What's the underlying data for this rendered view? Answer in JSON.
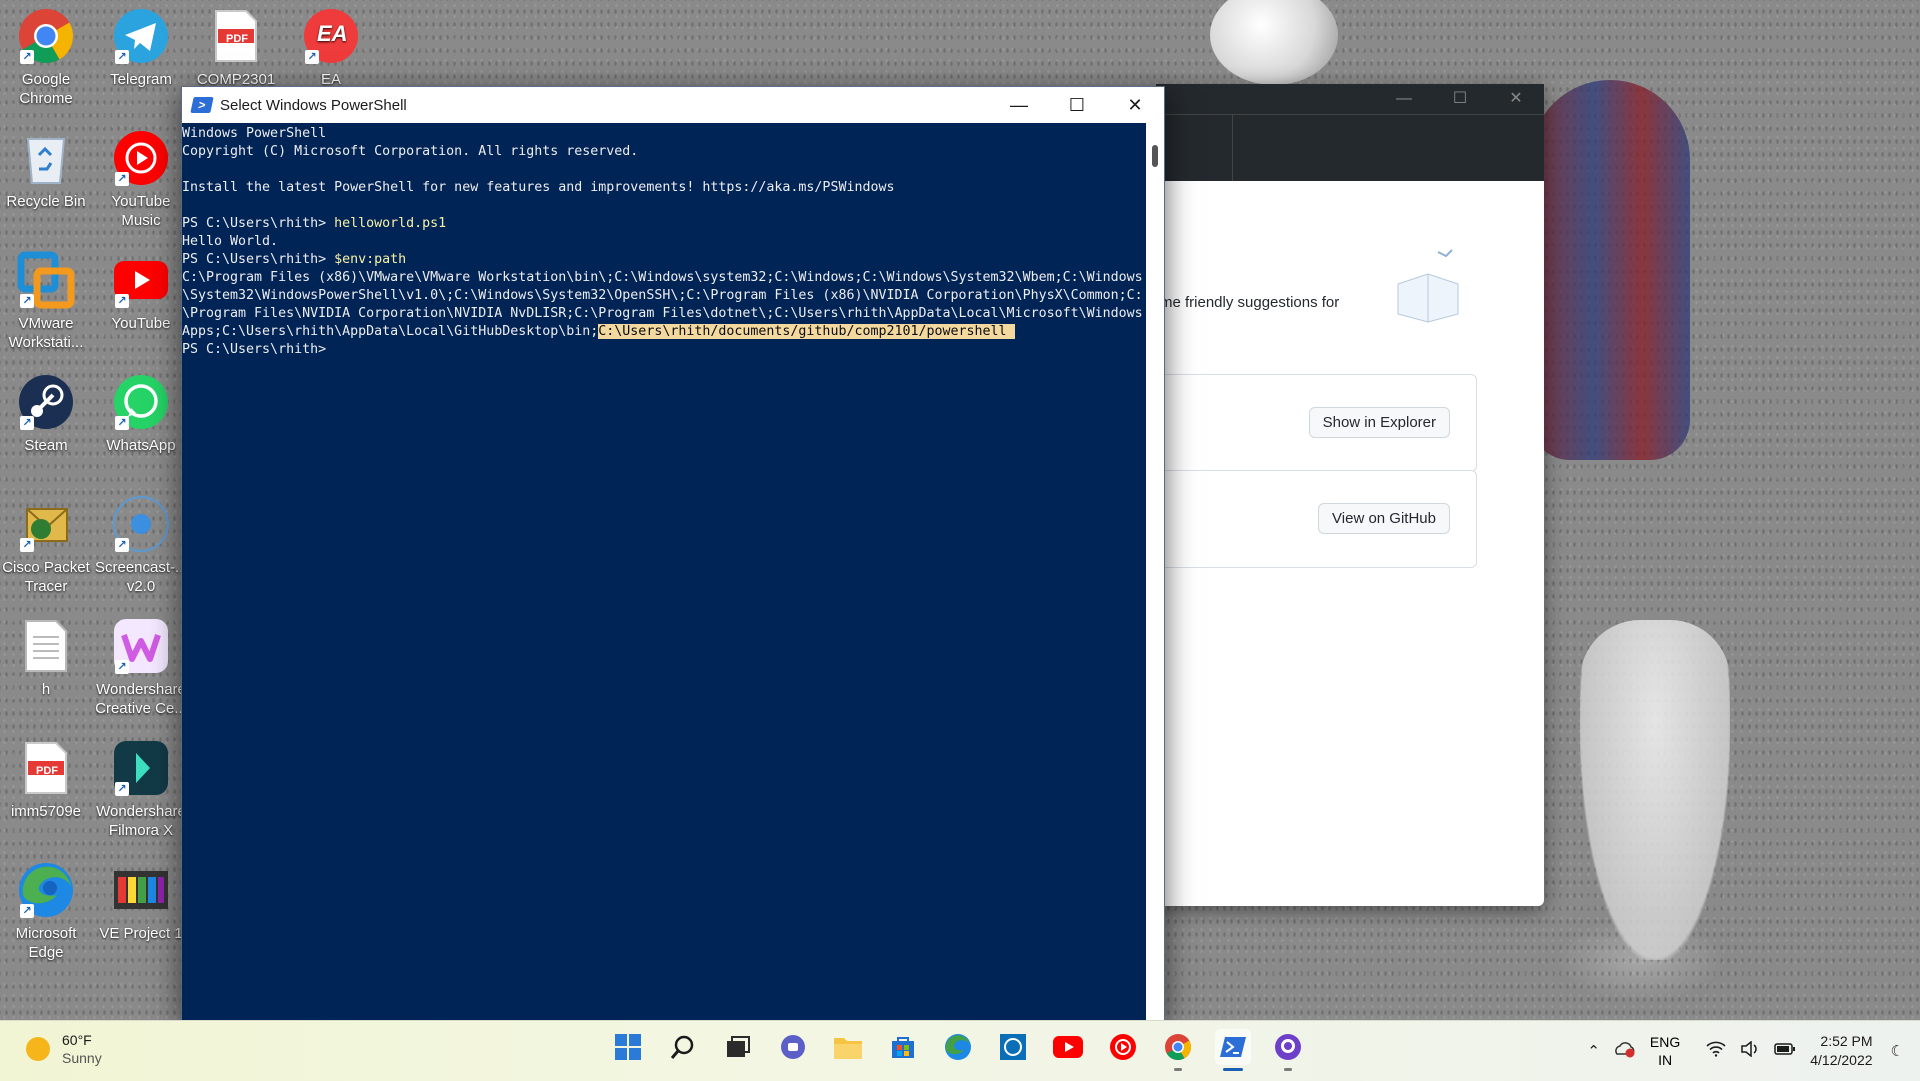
{
  "desktop": {
    "icons": [
      {
        "label": "Google Chrome"
      },
      {
        "label": "Telegram"
      },
      {
        "label": "COMP2301"
      },
      {
        "label": "EA"
      },
      {
        "label": "Recycle Bin"
      },
      {
        "label": "YouTube Music"
      },
      {
        "label": "VMware Workstati..."
      },
      {
        "label": "YouTube"
      },
      {
        "label": "Steam"
      },
      {
        "label": "WhatsApp"
      },
      {
        "label": "Cisco Packet Tracer"
      },
      {
        "label": "Screencast-... v2.0"
      },
      {
        "label": "h"
      },
      {
        "label": "Wondershare Creative Ce..."
      },
      {
        "label": "imm5709e"
      },
      {
        "label": "Wondershare Filmora X"
      },
      {
        "label": "Microsoft Edge"
      },
      {
        "label": "VE Project 1"
      }
    ],
    "pdf_badge": "PDF",
    "ea_badge": "EA"
  },
  "github_window": {
    "suggestion_text": "me friendly suggestions for",
    "show_in_explorer": "Show in Explorer",
    "view_on_github": "View on GitHub"
  },
  "powershell": {
    "title": "Select Windows PowerShell",
    "lines": [
      {
        "text": "Windows PowerShell"
      },
      {
        "text": "Copyright (C) Microsoft Corporation. All rights reserved."
      },
      {
        "text": ""
      },
      {
        "text": "Install the latest PowerShell for new features and improvements! https://aka.ms/PSWindows"
      },
      {
        "text": ""
      },
      {
        "prompt": "PS C:\\Users\\rhith> ",
        "cmd": "helloworld.ps1"
      },
      {
        "text": "Hello World."
      },
      {
        "prompt": "PS C:\\Users\\rhith> ",
        "cmd": "$env:path"
      },
      {
        "text": "C:\\Program Files (x86)\\VMware\\VMware Workstation\\bin\\;C:\\Windows\\system32;C:\\Windows;C:\\Windows\\System32\\Wbem;C:\\Windows"
      },
      {
        "text": "\\System32\\WindowsPowerShell\\v1.0\\;C:\\Windows\\System32\\OpenSSH\\;C:\\Program Files (x86)\\NVIDIA Corporation\\PhysX\\Common;C:"
      },
      {
        "text": "\\Program Files\\NVIDIA Corporation\\NVIDIA NvDLISR;C:\\Program Files\\dotnet\\;C:\\Users\\rhith\\AppData\\Local\\Microsoft\\Windows"
      },
      {
        "text": "Apps;C:\\Users\\rhith\\AppData\\Local\\GitHubDesktop\\bin;",
        "selected": "C:\\Users\\rhith/documents/github/comp2101/powershell "
      },
      {
        "prompt": "PS C:\\Users\\rhith>",
        "cmd": ""
      }
    ]
  },
  "taskbar": {
    "weather_temp": "60°F",
    "weather_cond": "Sunny",
    "apps": [
      {
        "name": "start"
      },
      {
        "name": "search"
      },
      {
        "name": "task-view"
      },
      {
        "name": "chat"
      },
      {
        "name": "file-explorer"
      },
      {
        "name": "microsoft-store"
      },
      {
        "name": "edge"
      },
      {
        "name": "dell"
      },
      {
        "name": "youtube"
      },
      {
        "name": "youtube-music"
      },
      {
        "name": "chrome"
      },
      {
        "name": "powershell",
        "active": true
      },
      {
        "name": "github-desktop"
      }
    ],
    "lang_top": "ENG",
    "lang_bottom": "IN",
    "time": "2:52 PM",
    "date": "4/12/2022"
  },
  "colors": {
    "ps_background": "#012456",
    "ps_command": "#f9f1a5",
    "ps_selection": "#f3d99e",
    "taskbar_active": "#1a5fb4"
  }
}
